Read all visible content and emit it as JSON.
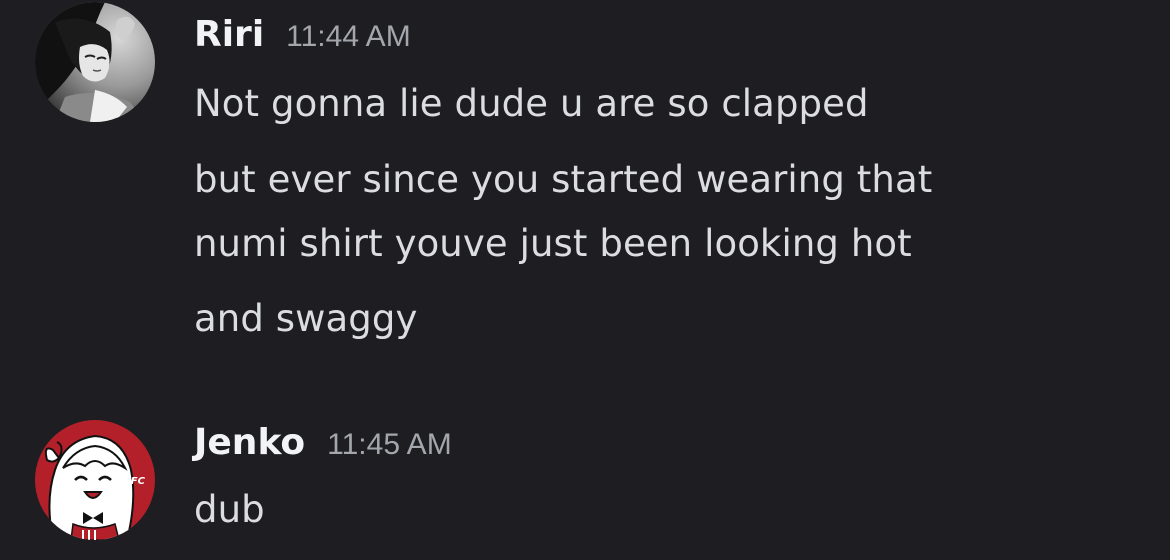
{
  "messages": [
    {
      "username": "Riri",
      "timestamp": "11:44 AM",
      "avatar_icon": "anime-avatar-grayscale",
      "lines": [
        "Not gonna lie dude u are so clapped",
        "but ever since you started wearing that",
        "numi shirt youve just been looking hot",
        "and swaggy"
      ]
    },
    {
      "username": "Jenko",
      "timestamp": "11:45 AM",
      "avatar_icon": "kfc-anime-avatar",
      "avatar_badge": "KFC",
      "lines": [
        "dub"
      ]
    }
  ],
  "colors": {
    "background": "#1e1e22",
    "username": "#f2f3f5",
    "timestamp": "#a4a6ad",
    "message_text": "#dcdde0",
    "kfc_red": "#b3202a"
  }
}
